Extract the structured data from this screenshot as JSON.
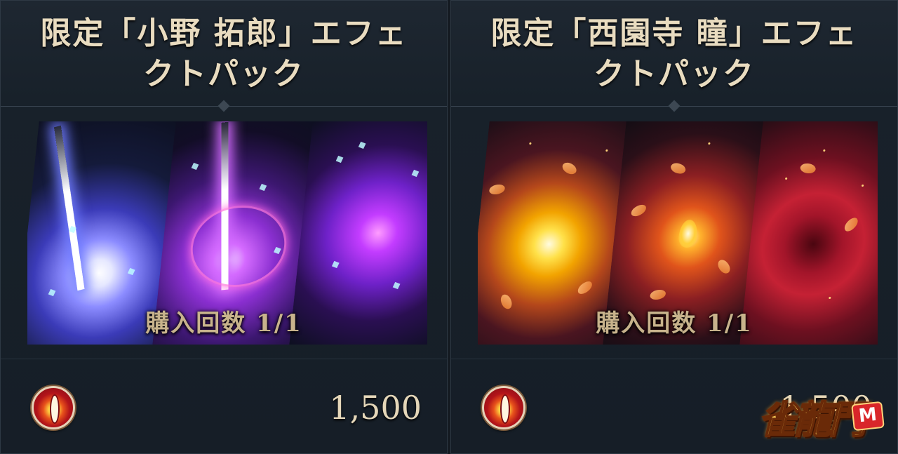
{
  "cards": [
    {
      "title_line1": "限定「小野 拓郎」エフェ",
      "title_line2": "クトパック",
      "purchase_count": "購入回数 1/1",
      "price": "1,500",
      "currency_icon": "red-gem-coin-icon"
    },
    {
      "title_line1": "限定「西園寺 瞳」エフェ",
      "title_line2": "クトパック",
      "purchase_count": "購入回数 1/1",
      "price": "1,500",
      "currency_icon": "red-gem-coin-icon"
    }
  ],
  "watermark": {
    "logo_text": "雀龍門",
    "badge": "M"
  },
  "colors": {
    "title": "#e9dcc0",
    "purchase_count": "#c8b38c",
    "price": "#e5d7b9",
    "card_bg": "#18212a",
    "divider": "#3a4652"
  }
}
